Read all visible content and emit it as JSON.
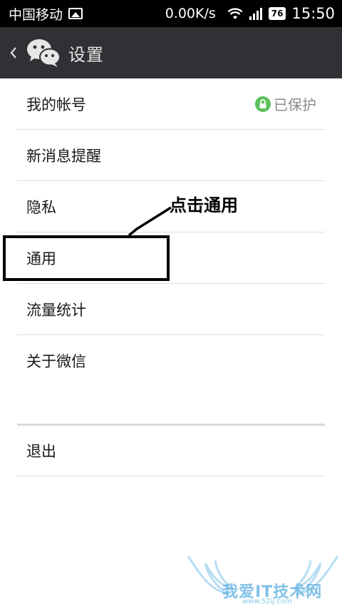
{
  "status_bar": {
    "carrier": "中国移动",
    "speed": "0.00K/s",
    "battery": "76",
    "time": "15:50"
  },
  "header": {
    "title": "设置"
  },
  "settings": {
    "items": [
      {
        "label": "我的帐号",
        "status": "已保护"
      },
      {
        "label": "新消息提醒"
      },
      {
        "label": "隐私"
      },
      {
        "label": "通用"
      },
      {
        "label": "流量统计"
      },
      {
        "label": "关于微信"
      }
    ],
    "logout_label": "退出"
  },
  "annotation": {
    "text": "点击通用"
  },
  "watermark": {
    "text": "我爱IT技术网",
    "sub": "www.52ij.com"
  },
  "colors": {
    "header_bg": "#2f3134",
    "protect_green": "#5cbf5a",
    "divider": "#dedede"
  }
}
